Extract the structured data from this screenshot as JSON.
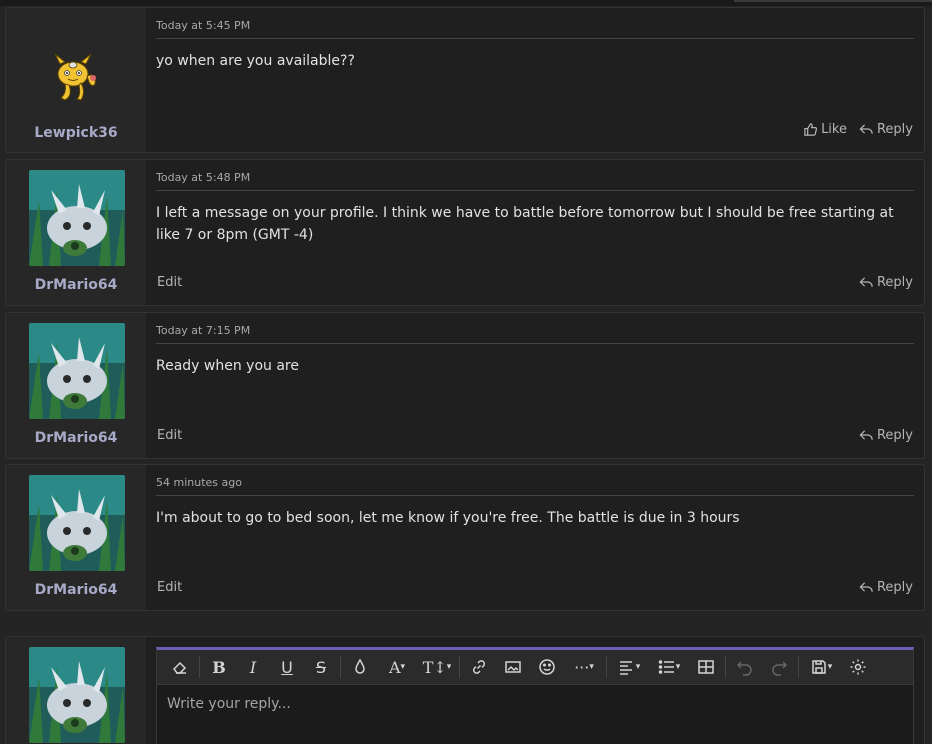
{
  "messages": [
    {
      "username": "Lewpick36",
      "date": "Today at 5:45 PM",
      "text": "yo when are you available??",
      "like_label": "Like",
      "reply_label": "Reply"
    },
    {
      "username": "DrMario64",
      "date": "Today at 5:48 PM",
      "text": "I left a message on your profile. I think we have to battle before tomorrow but I should be free starting at like 7 or 8pm (GMT -4)",
      "edit_label": "Edit",
      "reply_label": "Reply"
    },
    {
      "username": "DrMario64",
      "date": "Today at 7:15 PM",
      "text": "Ready when you are",
      "edit_label": "Edit",
      "reply_label": "Reply"
    },
    {
      "username": "DrMario64",
      "date": "54 minutes ago",
      "text": "I'm about to go to bed soon, let me know if you're free. The battle is due in 3 hours",
      "edit_label": "Edit",
      "reply_label": "Reply"
    }
  ],
  "editor": {
    "placeholder": "Write your reply...",
    "toolbar": [
      "eraser-icon",
      "bold-icon",
      "italic-icon",
      "underline-icon",
      "strikethrough-icon",
      "text-color-icon",
      "font-family-icon",
      "font-size-icon",
      "link-icon",
      "image-icon",
      "emoji-icon",
      "more-icon",
      "align-icon",
      "list-icon",
      "table-icon",
      "undo-icon",
      "redo-icon",
      "drafts-icon",
      "settings-icon"
    ]
  },
  "colors": {
    "background": "#242424",
    "message_bg": "#1f1f1f",
    "user_column_bg": "#272727",
    "username": "#a9a9c8",
    "editor_accent": "#6a5fb0"
  }
}
